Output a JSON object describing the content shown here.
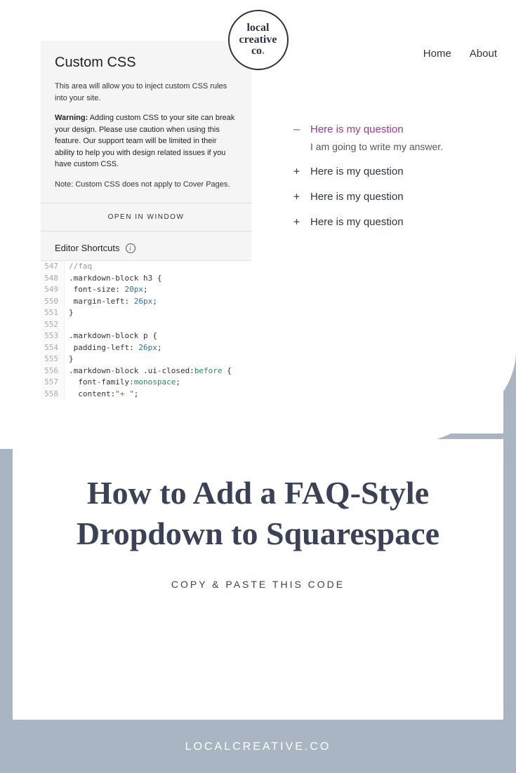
{
  "logo": {
    "line1": "local",
    "line2": "creative",
    "line3": "co",
    "dot": "."
  },
  "css_panel": {
    "title": "Custom CSS",
    "description": "This area will allow you to inject custom CSS rules into your site.",
    "warning_label": "Warning:",
    "warning": " Adding custom CSS to your site can break your design. Please use caution when using this feature. Our support team will be limited in their ability to help you with design related issues if you have custom CSS.",
    "note": "Note: Custom CSS does not apply to Cover Pages.",
    "open_button": "OPEN IN WINDOW",
    "shortcuts_label": "Editor Shortcuts"
  },
  "code_lines": [
    {
      "n": "547",
      "parts": [
        {
          "t": "//faq",
          "c": "c-comment"
        }
      ]
    },
    {
      "n": "548",
      "parts": [
        {
          "t": ".markdown-block h3 {",
          "c": "c-sel"
        }
      ]
    },
    {
      "n": "549",
      "parts": [
        {
          "t": " font-size: ",
          "c": "c-prop"
        },
        {
          "t": "20px",
          "c": "c-num"
        },
        {
          "t": ";",
          "c": "c-sel"
        }
      ]
    },
    {
      "n": "550",
      "parts": [
        {
          "t": " margin-left: ",
          "c": "c-prop"
        },
        {
          "t": "26px",
          "c": "c-num"
        },
        {
          "t": ";",
          "c": "c-sel"
        }
      ]
    },
    {
      "n": "551",
      "parts": [
        {
          "t": "}",
          "c": "c-sel"
        }
      ]
    },
    {
      "n": "552",
      "parts": [
        {
          "t": "",
          "c": ""
        }
      ]
    },
    {
      "n": "553",
      "parts": [
        {
          "t": ".markdown-block p {",
          "c": "c-sel"
        }
      ]
    },
    {
      "n": "554",
      "parts": [
        {
          "t": " padding-left: ",
          "c": "c-prop"
        },
        {
          "t": "26px",
          "c": "c-num"
        },
        {
          "t": ";",
          "c": "c-sel"
        }
      ]
    },
    {
      "n": "555",
      "parts": [
        {
          "t": "}",
          "c": "c-sel"
        }
      ]
    },
    {
      "n": "556",
      "parts": [
        {
          "t": ".markdown-block .ui-closed:",
          "c": "c-sel"
        },
        {
          "t": "before",
          "c": "c-kw"
        },
        {
          "t": " {",
          "c": "c-sel"
        }
      ]
    },
    {
      "n": "557",
      "parts": [
        {
          "t": "  font-family:",
          "c": "c-prop"
        },
        {
          "t": "monospace",
          "c": "c-kw"
        },
        {
          "t": ";",
          "c": "c-sel"
        }
      ]
    },
    {
      "n": "558",
      "parts": [
        {
          "t": "  content:",
          "c": "c-prop"
        },
        {
          "t": "\"+ \"",
          "c": "c-str"
        },
        {
          "t": ";",
          "c": "c-sel"
        }
      ]
    }
  ],
  "preview": {
    "nav": {
      "home": "Home",
      "about": "About"
    },
    "faq": [
      {
        "icon": "–",
        "q": "Here is my question",
        "open": true,
        "a": "I am going to write my answer."
      },
      {
        "icon": "+",
        "q": "Here is my question",
        "open": false
      },
      {
        "icon": "+",
        "q": "Here is my question",
        "open": false
      },
      {
        "icon": "+",
        "q": "Here is my question",
        "open": false
      }
    ]
  },
  "title": "How to Add a FAQ-Style Dropdown to Squarespace",
  "subtitle": "COPY & PASTE THIS CODE",
  "footer": "LOCALCREATIVE.CO"
}
